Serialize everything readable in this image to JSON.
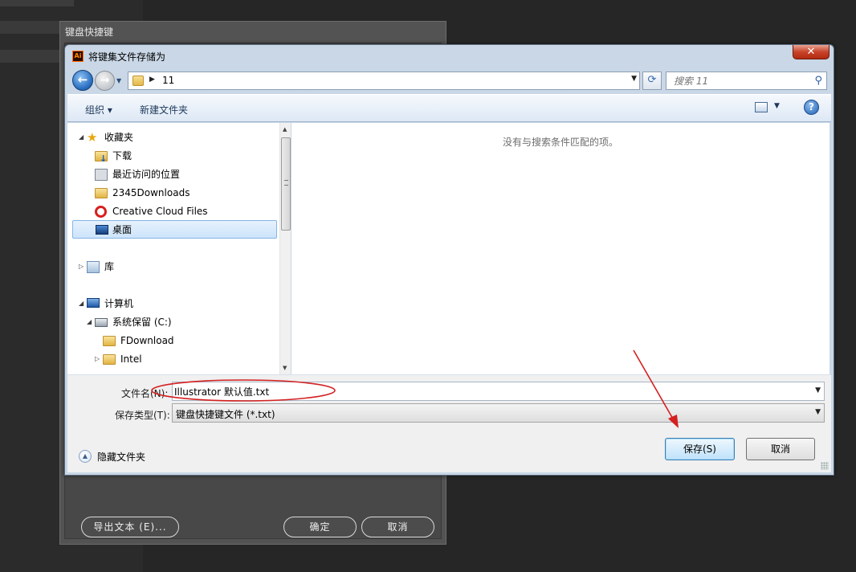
{
  "illustrator_panel": {
    "title": "键盘快捷键",
    "export_button": "导出文本 (E)...",
    "ok_button": "确定",
    "cancel_button": "取消"
  },
  "dialog": {
    "title": "将键集文件存储为",
    "app_icon_text": "Ai",
    "close_glyph": "✕",
    "address": {
      "path": "11",
      "search_placeholder": "搜索 11"
    },
    "toolbar": {
      "organize": "组织 ▾",
      "new_folder": "新建文件夹",
      "help": "?"
    },
    "nav_tree": {
      "favorites": "收藏夹",
      "downloads": "下载",
      "recent": "最近访问的位置",
      "folder_2345": "2345Downloads",
      "creative_cloud": "Creative Cloud Files",
      "desktop": "桌面",
      "libraries": "库",
      "computer": "计算机",
      "system_drive": "系统保留 (C:)",
      "fdownload": "FDownload",
      "intel": "Intel"
    },
    "content": {
      "empty_message": "没有与搜索条件匹配的项。"
    },
    "filename_label": "文件名(N):",
    "filename_value": "Illustrator 默认值.txt",
    "filetype_label": "保存类型(T):",
    "filetype_value": "键盘快捷键文件 (*.txt)",
    "hide_folders": "隐藏文件夹",
    "save_button": "保存(S)",
    "cancel_button": "取消"
  },
  "colors": {
    "annotation": "#d42020",
    "dialog_frame": "#c9d7e6",
    "selection": "#cde4fb"
  }
}
